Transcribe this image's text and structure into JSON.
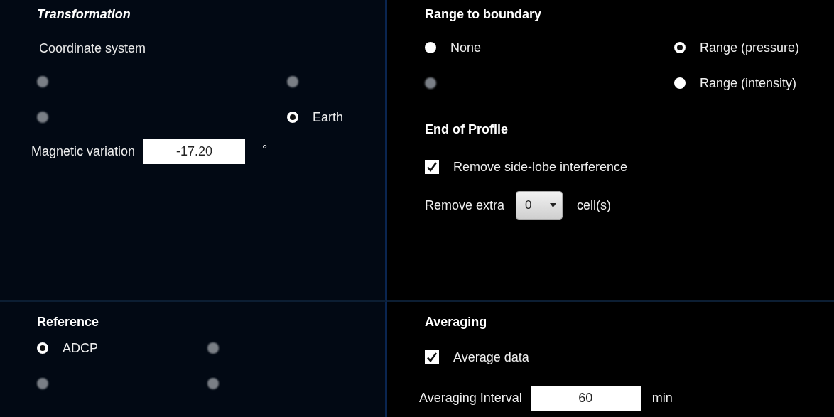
{
  "panels": [
    {
      "items": [
        {
          "kind": "heading",
          "text": "Transformation",
          "italic": true
        },
        {
          "kind": "label",
          "text": "Coordinate system"
        },
        {
          "kind": "radios",
          "options": [
            {
              "disabled": true,
              "selected": false
            },
            {
              "disabled": true,
              "selected": false
            },
            {
              "disabled": true,
              "selected": false
            },
            {
              "label": "Earth",
              "disabled": false,
              "selected": true
            }
          ]
        },
        {
          "kind": "input",
          "label": "Magnetic variation",
          "value": "-17.20",
          "unit": "°"
        }
      ]
    },
    {
      "items": [
        {
          "kind": "heading",
          "text": "Range to boundary",
          "italic": false
        },
        {
          "kind": "radios",
          "options": [
            {
              "label": "None",
              "disabled": false,
              "selected": false
            },
            {
              "label": "Range (pressure)",
              "disabled": false,
              "selected": true
            },
            {
              "disabled": true,
              "selected": false
            },
            {
              "label": "Range (intensity)",
              "disabled": false,
              "selected": false
            }
          ]
        },
        {
          "kind": "heading",
          "text": "End of Profile",
          "italic": false
        },
        {
          "kind": "checkbox",
          "label": "Remove side-lobe interference",
          "checked": true
        },
        {
          "kind": "dropdown",
          "label": "Remove extra",
          "value": "0",
          "unit": "cell(s)"
        }
      ]
    },
    {
      "items": [
        {
          "kind": "heading",
          "text": "Reference",
          "italic": false
        },
        {
          "kind": "radios",
          "options": [
            {
              "label": "ADCP",
              "disabled": false,
              "selected": true
            },
            {
              "disabled": true,
              "selected": false
            },
            {
              "disabled": true,
              "selected": false
            },
            {
              "disabled": true,
              "selected": false
            }
          ]
        }
      ]
    },
    {
      "items": [
        {
          "kind": "heading",
          "text": "Averaging",
          "italic": false
        },
        {
          "kind": "checkbox",
          "label": "Average data",
          "checked": true
        },
        {
          "kind": "input",
          "label": "Averaging Interval",
          "value": "60",
          "unit": "min"
        }
      ]
    }
  ]
}
